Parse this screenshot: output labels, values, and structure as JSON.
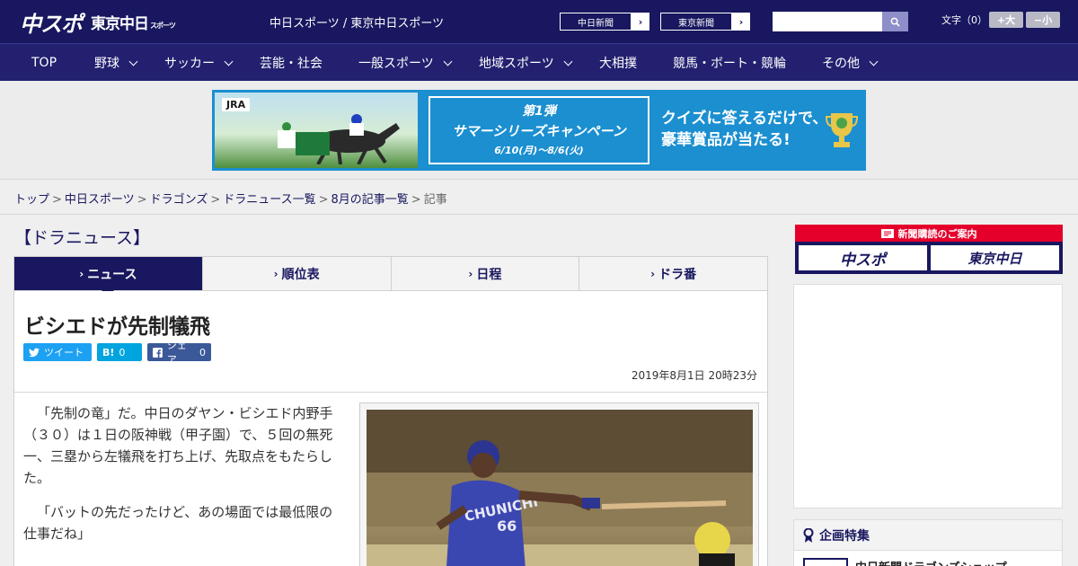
{
  "header": {
    "logo_main": "中スポ",
    "logo_sub": "東京中日",
    "logo_sub_small": "スポーツ",
    "site_title": "中日スポーツ / 東京中日スポーツ",
    "paper_buttons": [
      "中日新聞",
      "東京新聞"
    ],
    "search_placeholder": "",
    "font_size_label": "文字（0）",
    "font_larger": "+大",
    "font_smaller": "−小"
  },
  "nav": {
    "items": [
      {
        "label": "TOP",
        "has_menu": false
      },
      {
        "label": "野球",
        "has_menu": true
      },
      {
        "label": "サッカー",
        "has_menu": true
      },
      {
        "label": "芸能・社会",
        "has_menu": false
      },
      {
        "label": "一般スポーツ",
        "has_menu": true
      },
      {
        "label": "地域スポーツ",
        "has_menu": true
      },
      {
        "label": "大相撲",
        "has_menu": false
      },
      {
        "label": "競馬・ボート・競輪",
        "has_menu": false
      },
      {
        "label": "その他",
        "has_menu": true
      }
    ]
  },
  "banner": {
    "jra": "JRA",
    "campaign_line1": "第1弾",
    "campaign_line2": "サマーシリーズキャンペーン",
    "campaign_line3": "6/10(月)～8/6(火)",
    "quiz_line1": "クイズに答えるだけで、",
    "quiz_line2": "豪華賞品が当たる!"
  },
  "breadcrumb": {
    "links": [
      "トップ",
      "中日スポーツ",
      "ドラゴンズ",
      "ドラニュース一覧",
      "8月の記事一覧"
    ],
    "current": "記事"
  },
  "section_heading": "【ドラニュース】",
  "tabs": [
    {
      "label": "ニュース",
      "active": true
    },
    {
      "label": "順位表",
      "active": false
    },
    {
      "label": "日程",
      "active": false
    },
    {
      "label": "ドラ番",
      "active": false
    }
  ],
  "article": {
    "headline": "ビシエドが先制犠飛",
    "share": {
      "tweet": "ツイート",
      "hatena_icon": "B!",
      "hatena_count": "0",
      "fb_label": "シェア",
      "fb_count": "0"
    },
    "date": "2019年8月1日 20時23分",
    "paragraphs": [
      "「先制の竜」だ。中日のダヤン・ビシエド内野手（３０）は１日の阪神戦（甲子園）で、５回の無死一、三塁から左犠飛を打ち上げ、先取点をもたらした。",
      "「バットの先だったけど、あの場面では最低限の仕事だね」"
    ],
    "photo_uniform_text": "CHUNICHI",
    "photo_number": "66"
  },
  "sidebar": {
    "subscribe_title": "新聞購読のご案内",
    "subscribe_buttons": [
      "中スポ",
      "東京中日"
    ],
    "feature_title": "企画特集",
    "feature_item": "中日新聞ドラゴンズショップ"
  },
  "colors": {
    "brand_navy": "#18175f",
    "nav_bg": "#22206f",
    "accent_red": "#e4002b",
    "tweet_blue": "#1da1f2",
    "hatena_blue": "#00a4de",
    "facebook_blue": "#3b5998"
  },
  "icons": [
    "search-icon",
    "chevron-right-icon",
    "chevron-down-icon",
    "twitter-icon",
    "hatena-icon",
    "facebook-icon",
    "newspaper-icon",
    "ribbon-icon"
  ]
}
